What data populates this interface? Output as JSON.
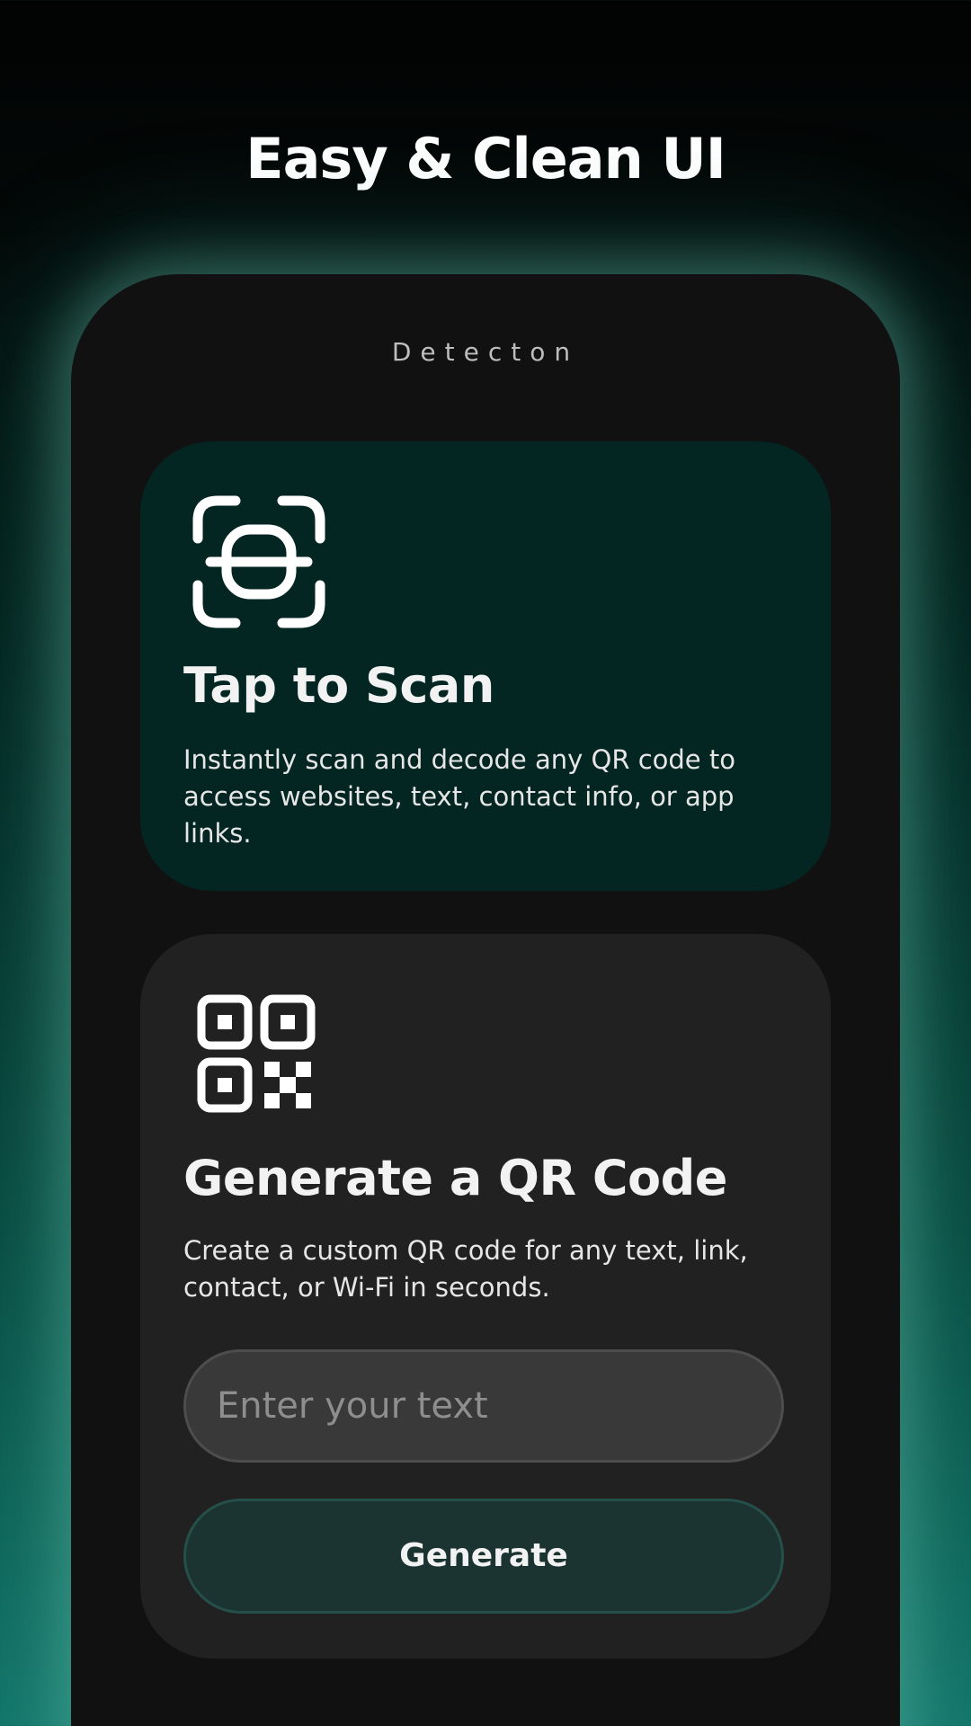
{
  "promo": {
    "headline": "Easy & Clean UI"
  },
  "app": {
    "title": "Detecton"
  },
  "scan_card": {
    "icon": "scan-frame-icon",
    "title": "Tap to Scan",
    "description": "Instantly scan and decode any QR code to access websites, text, contact info, or app links."
  },
  "generate_card": {
    "icon": "qr-code-icon",
    "title": "Generate a QR Code",
    "description": "Create a custom QR code for any text, link, contact, or Wi-Fi in seconds.",
    "input": {
      "value": "",
      "placeholder": "Enter your text"
    },
    "button_label": "Generate"
  },
  "colors": {
    "scan_card_bg": "#032622",
    "generate_card_bg": "#212121",
    "phone_bg": "#111111",
    "button_bg": "#1b3431",
    "accent_glow": "#78d2be"
  }
}
